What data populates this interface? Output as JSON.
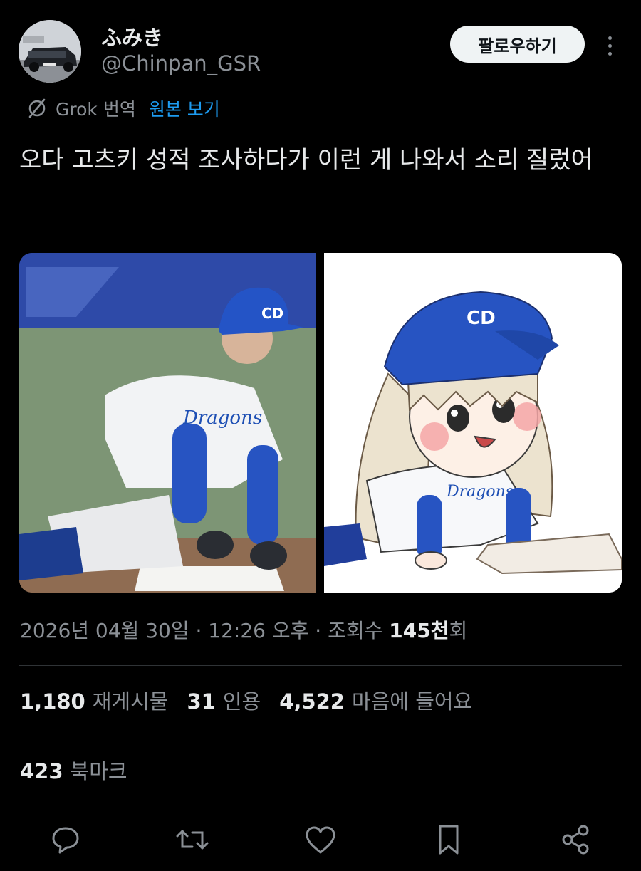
{
  "author": {
    "display_name": "ふみき",
    "handle": "@Chinpan_GSR"
  },
  "header": {
    "follow_label": "팔로우하기"
  },
  "translation": {
    "provider_label": "Grok 번역",
    "view_original_label": "원본 보기"
  },
  "tweet": {
    "text": "오다 고츠키 성적 조사하다가 이런 게 나와서 소리 질렀어"
  },
  "media": {
    "left_logo": "CD",
    "left_jersey_text": "Dragons",
    "right_logo": "CD",
    "right_jersey_text": "Dragons"
  },
  "meta": {
    "datetime": "2026년 04월 30일 · 12:26 오후 · 조회수 ",
    "views_number": "145천",
    "views_suffix": "회"
  },
  "stats": {
    "retweets_count": "1,180",
    "retweets_label": "재게시물",
    "quotes_count": "31",
    "quotes_label": "인용",
    "likes_count": "4,522",
    "likes_label": "마음에 들어요",
    "bookmarks_count": "423",
    "bookmarks_label": "북마크"
  },
  "colors": {
    "background": "#000000",
    "text_primary": "#e7e9ea",
    "text_secondary": "#8b9096",
    "link": "#1d9bf0",
    "divider": "#2f3336",
    "dragons_blue": "#1e4fb4"
  },
  "icons": [
    "reply-icon",
    "retweet-icon",
    "like-icon",
    "bookmark-icon",
    "share-icon",
    "grok-icon",
    "more-icon"
  ]
}
